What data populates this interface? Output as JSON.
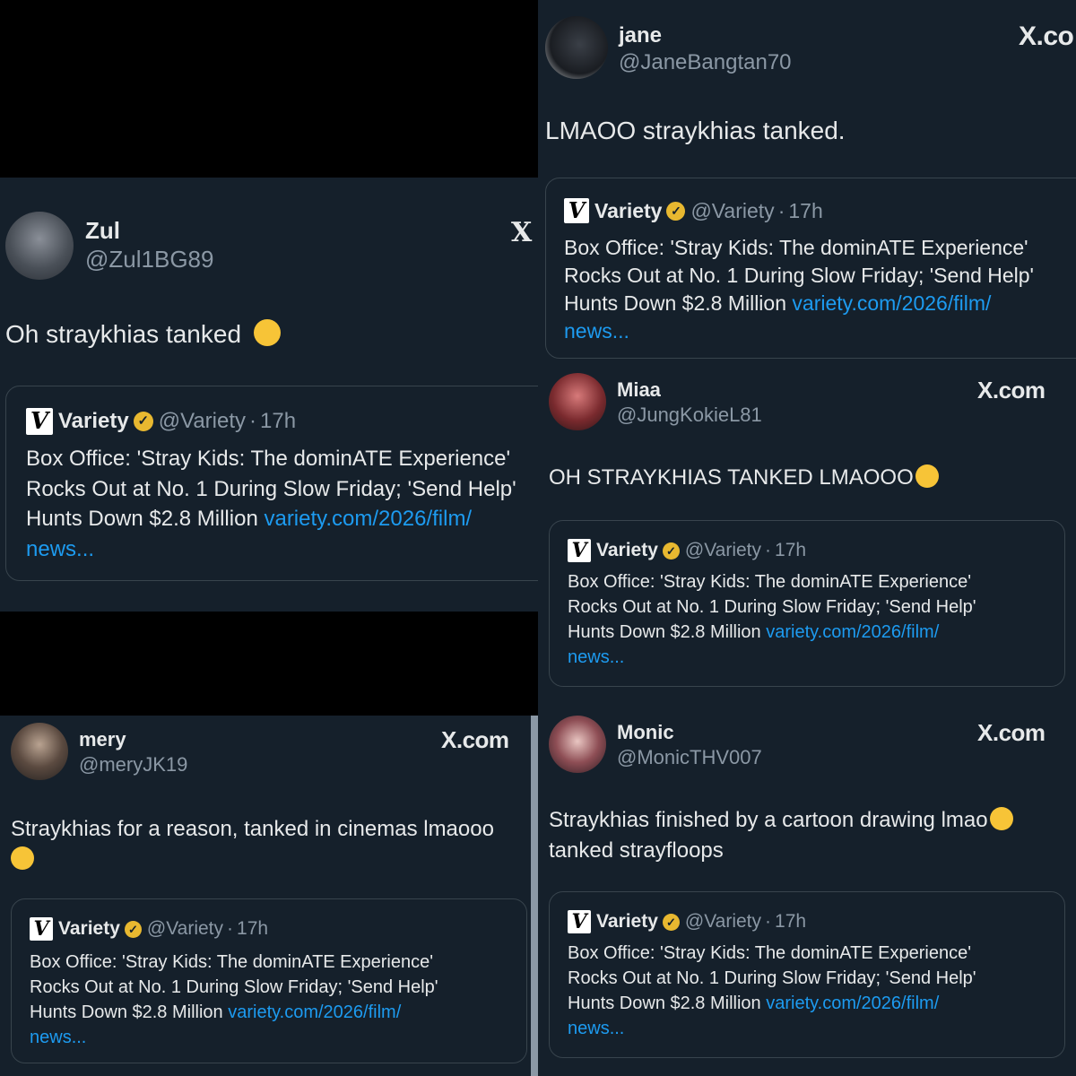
{
  "quote": {
    "source_name": "Variety",
    "source_handle": "@Variety",
    "sep": "·",
    "time": "17h",
    "logo_letter": "V",
    "headline_line1": "Box Office: 'Stray Kids: The dominATE Experience'",
    "headline_line2": "Rocks Out at No. 1 During Slow Friday; 'Send Help'",
    "headline_line3": "Hunts Down $2.8 Million",
    "link_line1": "variety.com/2026/film/",
    "link_line2": "news..."
  },
  "posts": {
    "jane": {
      "name": "jane",
      "handle": "@JaneBangtan70",
      "text": "LMAOO straykhias tanked.",
      "brand": "X.co"
    },
    "zul": {
      "name": "Zul",
      "handle": "@Zul1BG89",
      "text": "Oh straykhias tanked",
      "emoji": "loudly-crying-face",
      "brand": "X"
    },
    "miaa": {
      "name": "Miaa",
      "handle": "@JungKokieL81",
      "text": "OH STRAYKHIAS TANKED LMAOOO",
      "emoji": "tears-of-joy-face",
      "brand": "X.com"
    },
    "mery": {
      "name": "mery",
      "handle": "@meryJK19",
      "text_line1": "Straykhias for a reason, tanked in cinemas lmaooo",
      "emoji": "loudly-crying-face",
      "brand": "X.com"
    },
    "monic": {
      "name": "Monic",
      "handle": "@MonicTHV007",
      "text_line1": "Straykhias finished by a cartoon drawing lmao",
      "text_line2": "tanked strayfloops",
      "emoji": "loudly-crying-face",
      "brand": "X.com"
    }
  },
  "colors": {
    "background": "#15202b",
    "border": "#38444d",
    "link": "#1d9bf0",
    "muted": "#8b98a5",
    "badge": "#e8b830"
  }
}
